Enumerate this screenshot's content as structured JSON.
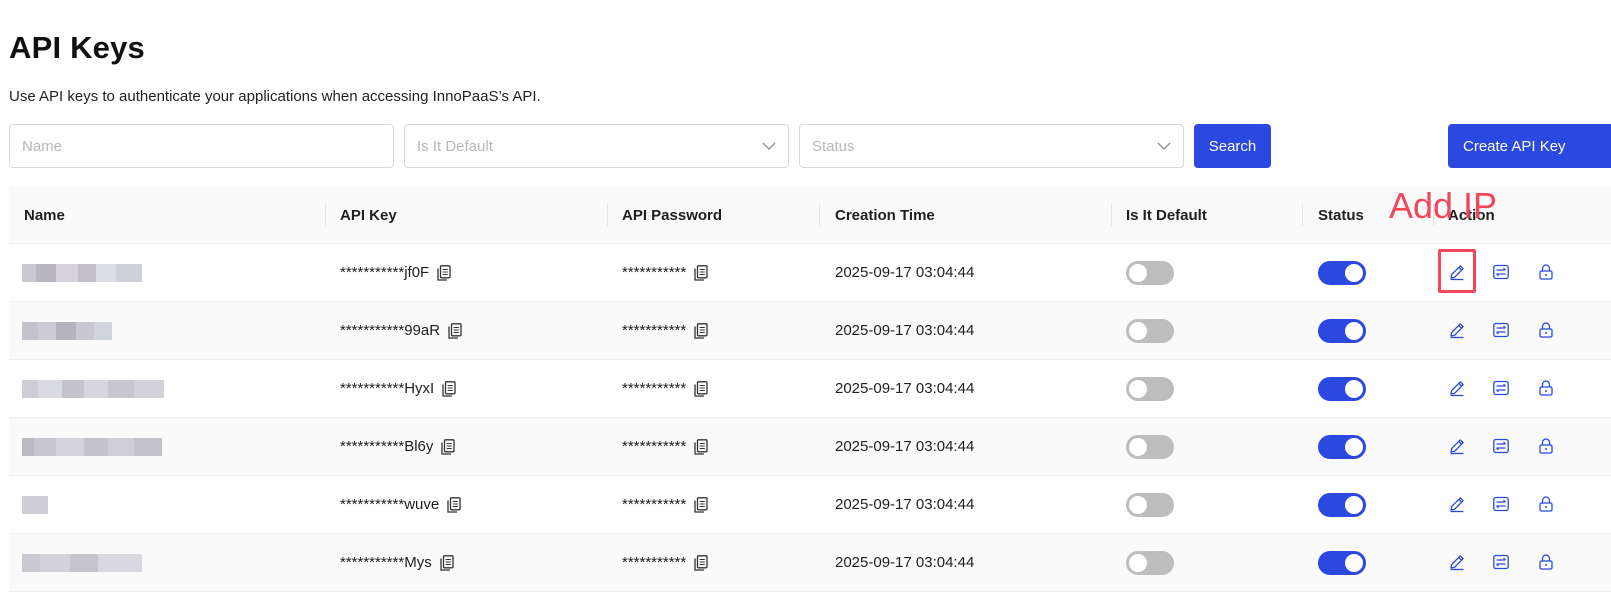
{
  "page": {
    "title": "API Keys",
    "subtitle": "Use API keys to authenticate your applications when accessing InnoPaaS’s API."
  },
  "filters": {
    "name_placeholder": "Name",
    "default_placeholder": "Is It Default",
    "status_placeholder": "Status",
    "search_label": "Search",
    "create_label": "Create API Key"
  },
  "table": {
    "columns": [
      "Name",
      "API Key",
      "API Password",
      "Creation Time",
      "Is It Default",
      "Status",
      "Action"
    ],
    "rows": [
      {
        "api_key": "***********jf0F",
        "api_password": "***********",
        "created": "2025-09-17 03:04:44",
        "is_default": false,
        "status": true
      },
      {
        "api_key": "***********99aR",
        "api_password": "***********",
        "created": "2025-09-17 03:04:44",
        "is_default": false,
        "status": true
      },
      {
        "api_key": "***********HyxI",
        "api_password": "***********",
        "created": "2025-09-17 03:04:44",
        "is_default": false,
        "status": true
      },
      {
        "api_key": "***********Bl6y",
        "api_password": "***********",
        "created": "2025-09-17 03:04:44",
        "is_default": false,
        "status": true
      },
      {
        "api_key": "***********wuve",
        "api_password": "***********",
        "created": "2025-09-17 03:04:44",
        "is_default": false,
        "status": true
      },
      {
        "api_key": "***********Mys",
        "api_password": "***********",
        "created": "2025-09-17 03:04:44",
        "is_default": false,
        "status": true
      }
    ]
  },
  "annotation": {
    "text": "Add IP",
    "color": "#f0475a"
  },
  "colors": {
    "accent": "#2b48e0",
    "toggle_off": "#bdbdbd"
  },
  "icons": {
    "copy": "copy-icon",
    "edit": "edit-icon",
    "ip": "ip-settings-icon",
    "lock": "lock-icon",
    "chevron": "chevron-down-icon"
  }
}
